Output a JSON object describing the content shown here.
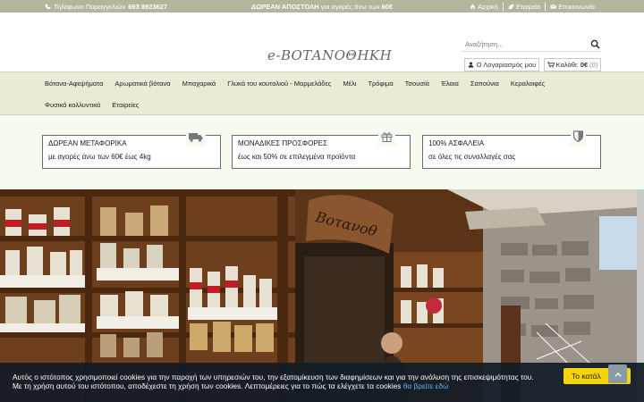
{
  "topbar": {
    "phone_label": "Τηλέφωνο Παραγγελιών",
    "phone_number": "693 8923627",
    "shipping_bold": "ΔΩΡΕΑΝ ΑΠΟΣΤΟΛΗ",
    "shipping_text": " για αγορές άνω των ",
    "shipping_amount": "60€",
    "links": [
      {
        "label": "Αρχική",
        "icon": "home-icon"
      },
      {
        "label": "Εταιρεία",
        "icon": "leaf-icon"
      },
      {
        "label": "Επικοινωνία",
        "icon": "envelope-icon"
      }
    ]
  },
  "header": {
    "logo_text": "e-ΒΟΤΑΝΟΘΗΚΗ",
    "search_placeholder": "Αναζήτηση...",
    "account_label": "Ο Λογαριασμός μου",
    "cart_label": "Καλάθι:",
    "cart_amount": "0€",
    "cart_count": "(0)"
  },
  "nav": {
    "items": [
      "Βότανα-Αφεψήματα",
      "Αρωματικά βότανα",
      "Μπαχαρικά",
      "Γλυκά του κουταλιού - Μαρμελάδες",
      "Μέλι",
      "Τρόφιμα",
      "Τσουσίά",
      "Έλαια",
      "Σαπούνια",
      "Κεραλοιφές",
      "Φυσικά καλλυντικά",
      "Εταιρείες"
    ]
  },
  "features": [
    {
      "title": "ΔΩΡΕΑΝ ΜΕΤΑΦΟΡΙΚΑ",
      "subtitle": "με αγορές άνω των 60€ έως 4kg",
      "icon": "truck-icon"
    },
    {
      "title": "ΜΟΝΑΔΙΚΕΣ ΠΡΟΣΦΟΡΕΣ",
      "subtitle": "έως και 50% σε επιλεγμένα προϊόντα",
      "icon": "gift-icon"
    },
    {
      "title": "100% ΑΣΦΑΛΕΙΑ",
      "subtitle": "σε όλες τις συναλλαγές σας",
      "icon": "shield-icon"
    }
  ],
  "hero": {
    "sign_text": "Βοτανοθ"
  },
  "cookie": {
    "text": "Αυτός ο ιστότοπος χρησιμοποιεί cookies για την παροχή των υπηρεσιών του, την εξατομίκευση των διαφημίσεων και για την ανάλυση της επισκεψιμότητας του. Με τη χρήση αυτού του ιστότοπου, αποδέχεστε τη χρήση των cookies. Λεπτομέρειες για το πώς τα ελέγχετε τα cookies ",
    "link": "θα βρείτε εδώ",
    "button": "Το κατάλ"
  },
  "colors": {
    "topbar": "#b7b49d",
    "nav": "#ece9d4",
    "features_bg": "#f5fbef",
    "cookie_button": "#f4d40c",
    "cookie_link": "#5bb1ff"
  }
}
